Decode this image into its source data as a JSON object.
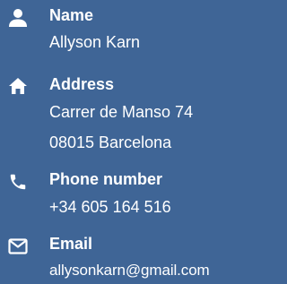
{
  "contact": {
    "name": {
      "icon": "person-icon",
      "label": "Name",
      "value": "Allyson Karn"
    },
    "address": {
      "icon": "home-icon",
      "label": "Address",
      "line1": "Carrer de Manso 74",
      "line2": "08015 Barcelona"
    },
    "phone": {
      "icon": "phone-icon",
      "label": "Phone number",
      "value": "+34 605 164 516"
    },
    "email": {
      "icon": "envelope-icon",
      "label": "Email",
      "value": "allysonkarn@gmail.com"
    }
  },
  "colors": {
    "background": "#3f6596",
    "text": "#ffffff"
  }
}
